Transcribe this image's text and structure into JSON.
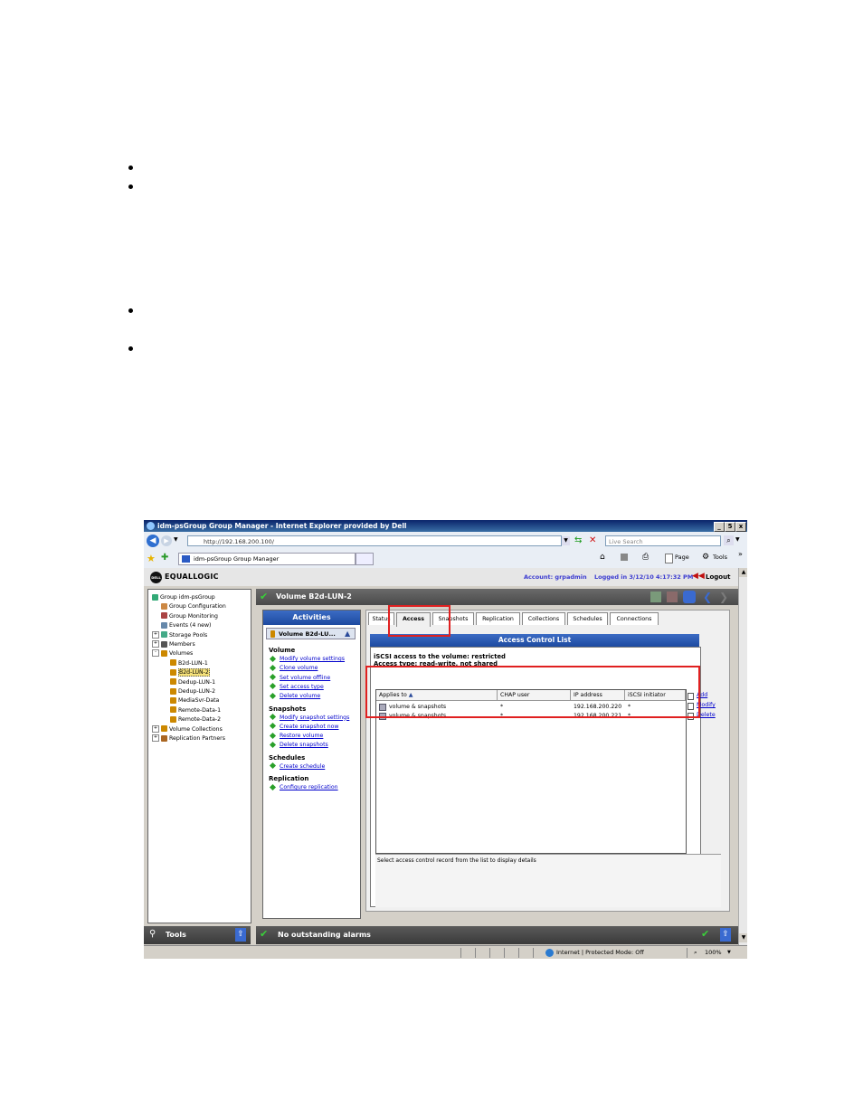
{
  "window": {
    "title": "idm-psGroup Group Manager - Internet Explorer provided by Dell",
    "minimize": "_",
    "restore": "5",
    "close": "x"
  },
  "browser": {
    "address": "http://192.168.200.100/",
    "search_placeholder": "Live Search",
    "tab_title": "idm-psGroup Group Manager",
    "page_menu": "Page",
    "tools_menu": "Tools",
    "more": "»",
    "zoom": "100%",
    "zone": "Internet | Protected Mode: Off"
  },
  "app": {
    "brand_dell": "DELL",
    "brand_name": "EQUALLOGIC",
    "account": "Account: grpadmin",
    "logged_in": "Logged in 3/12/10 4:17:32 PM",
    "logout": "Logout"
  },
  "tree": [
    {
      "label": "Group idm-psGroup",
      "indent": 0,
      "expander": "",
      "icon": "#3a7"
    },
    {
      "label": "Group Configuration",
      "indent": 1,
      "expander": "",
      "icon": "#c84"
    },
    {
      "label": "Group Monitoring",
      "indent": 1,
      "expander": "",
      "icon": "#a44"
    },
    {
      "label": "Events (4 new)",
      "indent": 1,
      "expander": "",
      "icon": "#68a"
    },
    {
      "label": "Storage Pools",
      "indent": 0,
      "expander": "+",
      "icon": "#4a8"
    },
    {
      "label": "Members",
      "indent": 0,
      "expander": "+",
      "icon": "#555"
    },
    {
      "label": "Volumes",
      "indent": 0,
      "expander": "-",
      "icon": "#c80"
    },
    {
      "label": "B2d-LUN-1",
      "indent": 2,
      "expander": "",
      "icon": "#c80"
    },
    {
      "label": "B2d-LUN-2",
      "indent": 2,
      "expander": "",
      "icon": "#c80",
      "selected": true
    },
    {
      "label": "Dedup-LUN-1",
      "indent": 2,
      "expander": "",
      "icon": "#c80"
    },
    {
      "label": "Dedup-LUN-2",
      "indent": 2,
      "expander": "",
      "icon": "#c80"
    },
    {
      "label": "MediaSvr-Data",
      "indent": 2,
      "expander": "",
      "icon": "#c80"
    },
    {
      "label": "Remote-Data-1",
      "indent": 2,
      "expander": "",
      "icon": "#c80"
    },
    {
      "label": "Remote-Data-2",
      "indent": 2,
      "expander": "",
      "icon": "#c80"
    },
    {
      "label": "Volume Collections",
      "indent": 0,
      "expander": "+",
      "icon": "#c80"
    },
    {
      "label": "Replication Partners",
      "indent": 0,
      "expander": "+",
      "icon": "#a62"
    }
  ],
  "volume": {
    "title": "Volume B2d-LUN-2"
  },
  "activities": {
    "header": "Activities",
    "selector": "Volume B2d-LU...",
    "sections": [
      {
        "title": "Volume",
        "links": [
          "Modify volume settings",
          "Clone volume",
          "Set volume offline",
          "Set access type",
          "Delete volume"
        ]
      },
      {
        "title": "Snapshots",
        "links": [
          "Modify snapshot settings",
          "Create snapshot now",
          "Restore volume",
          "Delete snapshots"
        ]
      },
      {
        "title": "Schedules",
        "links": [
          "Create schedule"
        ]
      },
      {
        "title": "Replication",
        "links": [
          "Configure replication"
        ]
      }
    ]
  },
  "tabs": [
    "Status",
    "Access",
    "Snapshots",
    "Replication",
    "Collections",
    "Schedules",
    "Connections"
  ],
  "acl": {
    "header": "Access Control List",
    "access_line": "iSCSI access to the volume: restricted",
    "type_line": "Access type: read-write, not shared",
    "columns": [
      "Applies to",
      "CHAP user",
      "IP address",
      "iSCSI initiator"
    ],
    "rows": [
      [
        "volume & snapshots",
        "*",
        "192.168.200.220",
        "*"
      ],
      [
        "volume & snapshots",
        "*",
        "192.168.200.221",
        "*"
      ]
    ],
    "actions": [
      "Add",
      "Modify",
      "Delete"
    ],
    "detail_hint": "Select access control record from the list to display details"
  },
  "footer": {
    "tools": "Tools",
    "alarms": "No outstanding alarms"
  }
}
